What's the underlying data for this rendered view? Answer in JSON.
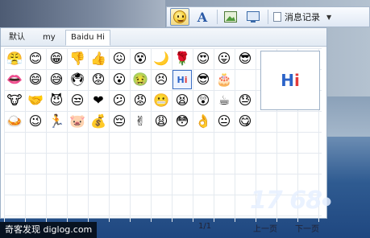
{
  "toolbar": {
    "history_label": "消息记录",
    "icons": [
      "emoticon-icon",
      "font-icon",
      "picture-icon",
      "screenshot-icon",
      "history-icon"
    ]
  },
  "panel": {
    "tabs": [
      "默认",
      "my",
      "Baidu Hi"
    ],
    "active_tab": "Baidu Hi",
    "preview_text_h": "H",
    "preview_text_i": "i",
    "emoticons": [
      "😤",
      "😊",
      "😁",
      "👎",
      "👍",
      "😖",
      "😵",
      "🌙",
      "🌹",
      "😍",
      "😛",
      "😎",
      "👄",
      "😄",
      "😅",
      "🖲",
      "😟",
      "😮",
      "🤢",
      "😣",
      "Hi",
      "😎",
      "🎂",
      "🐮",
      "🤝",
      "😈",
      "😒",
      "❤",
      "😕",
      "😡",
      "😬",
      "😫",
      "😲",
      "☕",
      "😓",
      "🍛",
      "😉",
      "🏃",
      "🐷",
      "💰",
      "😔",
      "✌",
      "😩",
      "😳",
      "👌",
      "😐",
      "😋"
    ]
  },
  "footer": {
    "watermark": "奇客发现 diglog.com",
    "page": "1/1",
    "prev": "上一页",
    "next": "下一页",
    "logo_text": "17 68",
    "logo_dot": "●"
  }
}
